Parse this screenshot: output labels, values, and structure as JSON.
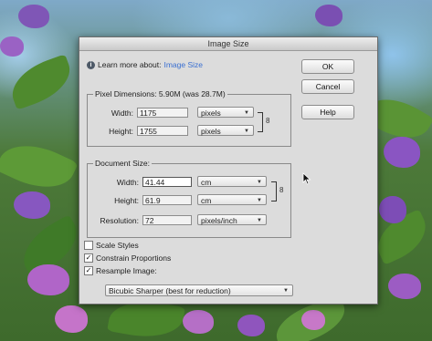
{
  "dialog": {
    "title": "Image Size",
    "learn_prefix": "Learn more about:",
    "learn_link": "Image Size"
  },
  "buttons": {
    "ok": "OK",
    "cancel": "Cancel",
    "help": "Help"
  },
  "pixel_dimensions": {
    "legend": "Pixel Dimensions: 5.90M (was 28.7M)",
    "width_label": "Width:",
    "width_value": "1175",
    "width_unit": "pixels",
    "height_label": "Height:",
    "height_value": "1755",
    "height_unit": "pixels"
  },
  "document_size": {
    "legend": "Document Size:",
    "width_label": "Width:",
    "width_value": "41.44",
    "width_unit": "cm",
    "height_label": "Height:",
    "height_value": "61.9",
    "height_unit": "cm",
    "resolution_label": "Resolution:",
    "resolution_value": "72",
    "resolution_unit": "pixels/inch"
  },
  "options": {
    "scale_styles": {
      "label": "Scale Styles",
      "checked": false
    },
    "constrain_proportions": {
      "label": "Constrain Proportions",
      "checked": true
    },
    "resample_image": {
      "label": "Resample Image:",
      "checked": true
    }
  },
  "resample_method": "Bicubic Sharper (best for reduction)",
  "colors": {
    "dialog_bg": "#dcdcdc",
    "link": "#3a6fd1"
  }
}
